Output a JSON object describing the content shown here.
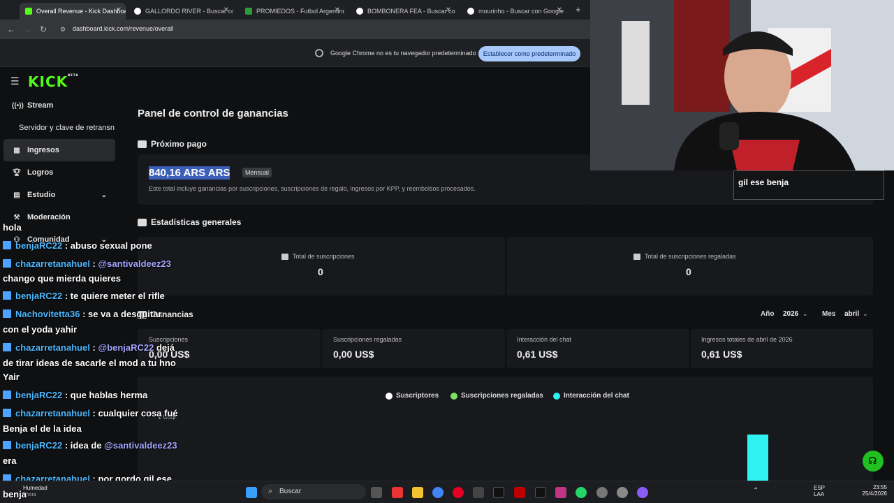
{
  "browser": {
    "tabs": [
      {
        "title": "Overall Revenue - Kick Dashboa",
        "active": true
      },
      {
        "title": "GALLORDO RIVER - Buscar con"
      },
      {
        "title": "PROMIEDOS - Futbol Argentino"
      },
      {
        "title": "BOMBONERA FEA - Buscar con"
      },
      {
        "title": "mourinho - Buscar con Google"
      }
    ],
    "url": "dashboard.kick.com/revenue/overall",
    "infobar_text": "Google Chrome no es tu navegador predeterminado",
    "infobar_button": "Establecer como predeterminado"
  },
  "sidebar": {
    "logo": "KICK",
    "logo_sup": "BETA",
    "items": [
      {
        "label": "Stream",
        "icon": "broadcast-icon"
      },
      {
        "label": "Servidor y clave de retransn",
        "icon": ""
      },
      {
        "label": "Ingresos",
        "icon": "chart-icon",
        "active": true
      },
      {
        "label": "Logros",
        "icon": "trophy-icon"
      },
      {
        "label": "Estudio",
        "icon": "studio-icon"
      },
      {
        "label": "Moderación",
        "icon": "hammer-icon"
      },
      {
        "label": "Comunidad",
        "icon": "community-icon"
      }
    ]
  },
  "main": {
    "title": "Panel de control de ganancias",
    "next_payment": {
      "heading": "Próximo pago",
      "amount": "840,16 ARS ARS",
      "badge": "Mensual",
      "description": "Este total incluye ganancias por suscripciones, suscripciones de regalo, ingresos por KPP, y reembolsos procesados."
    },
    "general_stats": {
      "heading": "Estadísticas generales",
      "items": [
        {
          "label": "Total de suscripciones",
          "value": "0"
        },
        {
          "label": "Total de suscripciones regaladas",
          "value": "0"
        }
      ]
    },
    "earnings": {
      "heading": "Ganancias",
      "year_label": "Año",
      "year_value": "2026",
      "month_label": "Mes",
      "month_value": "abril",
      "stats": [
        {
          "label": "Suscripciones",
          "value": "0,00 US$"
        },
        {
          "label": "Suscripciones regaladas",
          "value": "0,00 US$"
        },
        {
          "label": "Interacción del chat",
          "value": "0,61 US$"
        },
        {
          "label": "Ingresos totales de abril de 2026",
          "value": "0,61 US$"
        }
      ]
    },
    "legend": [
      {
        "label": "Suscriptores",
        "color": "#ffffff"
      },
      {
        "label": "Suscripciones regaladas",
        "color": "#7ee35c"
      },
      {
        "label": "Interacción del chat",
        "color": "#2ef2f2"
      }
    ],
    "y_tick": "1 US$"
  },
  "chat_box_text": "gil ese benja",
  "overlay_chat": [
    {
      "text": "hola"
    },
    {
      "user": "benjaRC22",
      "msg": " : abuso sexual pone"
    },
    {
      "user": "chazarretanahuel",
      "msg": " : ",
      "mention": "@santivaldeez23"
    },
    {
      "text": "chango que mierda quieres"
    },
    {
      "user": "benjaRC22",
      "msg": " : te quiere meter el rifle"
    },
    {
      "user": "Nachovitetta36",
      "msg": " : se va a desquitar"
    },
    {
      "text": "con el yoda yahir"
    },
    {
      "user": "chazarretanahuel",
      "msg": " : ",
      "mention": "@benjaRC22",
      "msg2": " dejá"
    },
    {
      "text": "de tirar ideas de sacarle el mod a tu hno"
    },
    {
      "text": "Yair"
    },
    {
      "user": "benjaRC22",
      "msg": " : que hablas herma"
    },
    {
      "user": "chazarretanahuel",
      "msg": " : cualquier cosa fué"
    },
    {
      "text": "Benja el de la idea"
    },
    {
      "user": "benjaRC22",
      "msg": " : idea de ",
      "mention": "@santivaldeez23"
    },
    {
      "text": "era"
    },
    {
      "user": "chazarretanahuel",
      "msg": " : por gordo gil ese"
    },
    {
      "text": "benja"
    }
  ],
  "taskbar": {
    "weather_title": "Humedad",
    "weather_sub": "Ahora",
    "search_placeholder": "Buscar",
    "lang": "ESP",
    "lang2": "LAA",
    "time": "23:55",
    "date": "25/4/2026"
  },
  "chart_data": {
    "type": "bar",
    "series": [
      {
        "name": "Interacción del chat",
        "values": [
          0.61
        ]
      }
    ],
    "y_ticks": [
      "1 US$"
    ]
  }
}
